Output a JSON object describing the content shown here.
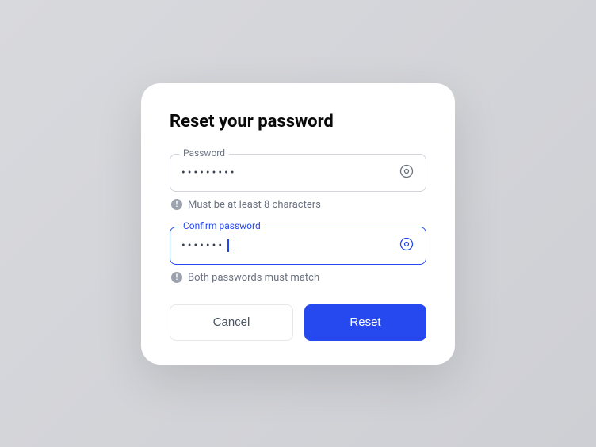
{
  "title": "Reset your password",
  "fields": {
    "password": {
      "label": "Password",
      "value": "•••••••••",
      "hint": "Must be at least 8 characters"
    },
    "confirm": {
      "label": "Confirm password",
      "value": "•••••••",
      "hint": "Both passwords must match"
    }
  },
  "buttons": {
    "cancel": "Cancel",
    "reset": "Reset"
  },
  "colors": {
    "accent": "#2549ee"
  }
}
